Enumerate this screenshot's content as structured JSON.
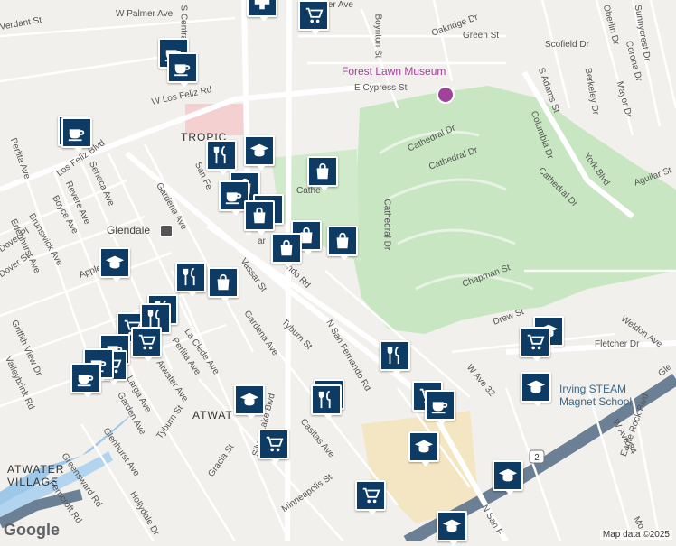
{
  "map": {
    "places": {
      "forest_lawn": "Forest Lawn Museum",
      "glendale": "Glendale",
      "tropico": "TROPIC",
      "atwater_village": [
        "ATWATER",
        "VILLAGE"
      ],
      "atwater": "ATWAT",
      "irving_school": [
        "Irving STEAM",
        "Magnet School"
      ]
    },
    "streets": [
      "W Palmer Ave",
      "Palmer Ave",
      "S Central",
      "Boynton St",
      "Oakridge Dr",
      "Green St",
      "Scofield Dr",
      "Oberlin Dr",
      "Sunnycrest Dr",
      "Corona Dr",
      "Berkeley Dr",
      "Mayor Dr",
      "Verdant St",
      "E Cypress St",
      "W Los Feliz Rd",
      "S Adams St",
      "Columbia Dr",
      "York Blvd",
      "Aguilar St",
      "Cathedral Dr",
      "Cathedral Dr",
      "Cathedral Dr",
      "Cathedral Dr",
      "Cathe",
      "Los Feliz Blvd",
      "Perlita Ave",
      "Seneca Ave",
      "Revere Ave",
      "Boyce Ave",
      "Brunswick Ave",
      "Edenhurst Ave",
      "Dover Pl",
      "Dover St",
      "Gardena Ave",
      "San Fe",
      "ar",
      "indo Rd",
      "Vassar St",
      "Appleton",
      "Chapman St",
      "Drew St",
      "Weldon Ave",
      "Fletcher Dr",
      "Tyburn St",
      "N San Fernando Rd",
      "La Clede Ave",
      "Gardena Ave",
      "Perlita Ave",
      "Atwater Ave",
      "Larga Ave",
      "Garden Ave",
      "Griffith View Dr",
      "Valleybrink Rd",
      "W Ave 32",
      "W Ave 34",
      "Eagle Rock Blvd",
      "Casitas Ave",
      "Tyburn St",
      "Glenhurst Ave",
      "Gracia St",
      "Silver Lake Blvd",
      "Minneapolis St",
      "Greensward Rd",
      "Ferncroft Rd",
      "Hollydale Dr",
      "N San F",
      "Mo",
      "Gle"
    ],
    "route_shield": "2",
    "footer": {
      "logo": "Google",
      "credit": "Map data ©2025"
    },
    "pins": [
      {
        "type": "grocery"
      },
      {
        "type": "pharmacy"
      },
      {
        "type": "cafe"
      },
      {
        "type": "cafe"
      },
      {
        "type": "cafe"
      },
      {
        "type": "cafe"
      },
      {
        "type": "restaurant"
      },
      {
        "type": "school"
      },
      {
        "type": "shopping"
      },
      {
        "type": "shopping"
      },
      {
        "type": "cafe"
      },
      {
        "type": "shopping"
      },
      {
        "type": "shopping"
      },
      {
        "type": "shopping"
      },
      {
        "type": "shopping"
      },
      {
        "type": "shopping"
      },
      {
        "type": "restaurant"
      },
      {
        "type": "shopping"
      },
      {
        "type": "school"
      },
      {
        "type": "restaurant"
      },
      {
        "type": "grocery"
      },
      {
        "type": "restaurant"
      },
      {
        "type": "cafe"
      },
      {
        "type": "grocery"
      },
      {
        "type": "grocery"
      },
      {
        "type": "cafe"
      },
      {
        "type": "cafe"
      },
      {
        "type": "restaurant"
      },
      {
        "type": "school"
      },
      {
        "type": "grocery"
      },
      {
        "type": "restaurant"
      },
      {
        "type": "grocery"
      },
      {
        "type": "restaurant"
      },
      {
        "type": "cafe"
      },
      {
        "type": "school"
      },
      {
        "type": "school"
      },
      {
        "type": "grocery"
      },
      {
        "type": "school"
      },
      {
        "type": "grocery"
      },
      {
        "type": "school"
      },
      {
        "type": "school"
      }
    ]
  }
}
